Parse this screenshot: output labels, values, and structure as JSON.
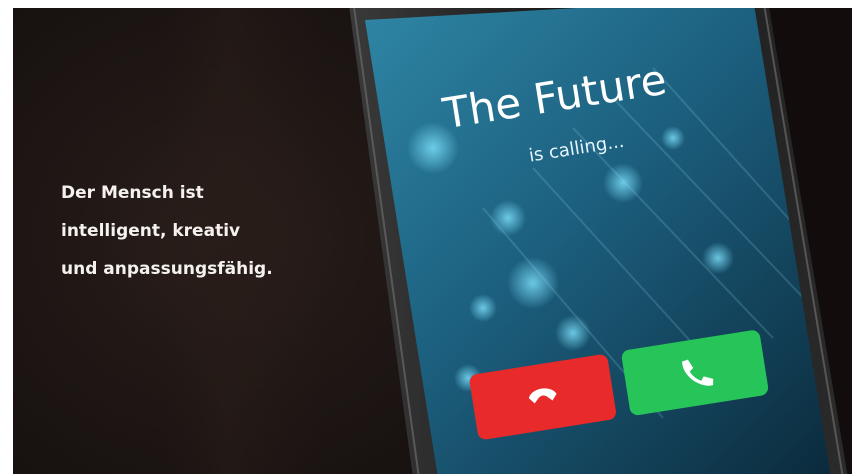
{
  "caption": {
    "line1": "Der Mensch ist",
    "line2": "intelligent, kreativ",
    "line3": "und anpassungsfähig."
  },
  "phone": {
    "title": "The Future",
    "subtitle": "is calling...",
    "decline_icon": "phone-hangup-icon",
    "accept_icon": "phone-icon",
    "decline_color": "#e82a2a",
    "accept_color": "#27c45a"
  }
}
